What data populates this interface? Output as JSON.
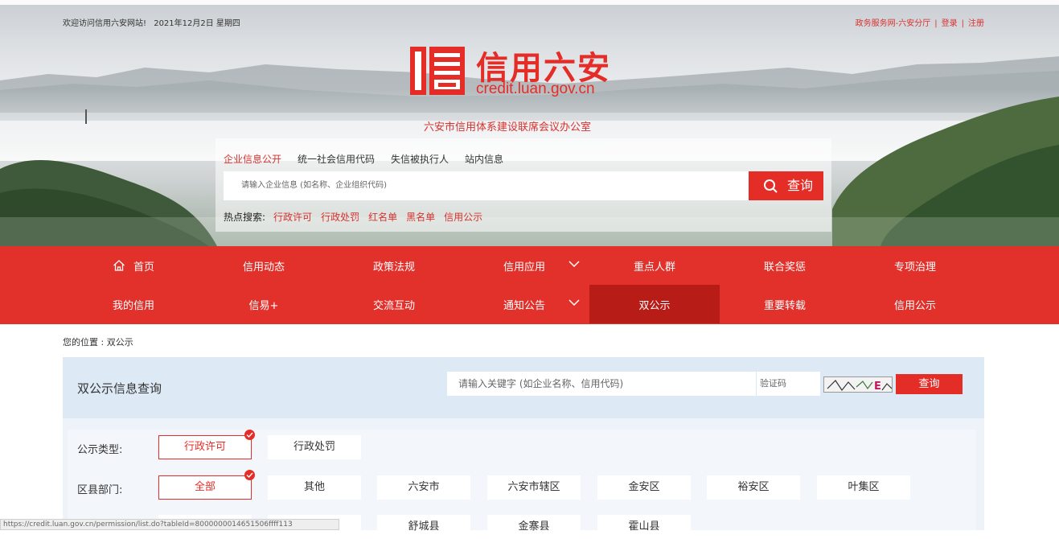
{
  "header": {
    "welcome": "欢迎访问信用六安网站!",
    "date": "2021年12月2日 星期四",
    "links": [
      "政务服务网-六安分厅",
      "登录",
      "注册"
    ],
    "separator": "|"
  },
  "logo": {
    "title": "信用六安",
    "domain": "credit.luan.gov.cn",
    "office": "六安市信用体系建设联席会议办公室"
  },
  "search": {
    "tabs": [
      "企业信息公开",
      "统一社会信用代码",
      "失信被执行人",
      "站内信息"
    ],
    "active_tab": 0,
    "placeholder": "请输入企业信息 (如名称、企业组织代码)",
    "button": "查询",
    "hot_label": "热点搜索:",
    "hot_links": [
      "行政许可",
      "行政处罚",
      "红名单",
      "黑名单",
      "信用公示"
    ]
  },
  "nav": {
    "row1": [
      "首页",
      "信用动态",
      "政策法规",
      "信用应用",
      "重点人群",
      "联合奖惩",
      "专项治理"
    ],
    "row2": [
      "我的信用",
      "信易+",
      "交流互动",
      "通知公告",
      "双公示",
      "重要转载",
      "信用公示"
    ],
    "active": "双公示"
  },
  "breadcrumb": "您的位置 : 双公示",
  "query": {
    "title": "双公示信息查询",
    "keyword_placeholder": "请输入关键字 (如企业名称、信用代码)",
    "captcha_placeholder": "验证码",
    "button": "查询"
  },
  "filters": {
    "type_label": "公示类型:",
    "types": [
      "行政许可",
      "行政处罚"
    ],
    "type_selected": "行政许可",
    "dept_label": "区县部门:",
    "depts_row1": [
      "全部",
      "其他",
      "六安市",
      "六安市辖区",
      "金安区",
      "裕安区",
      "叶集区"
    ],
    "depts_row2": [
      "",
      "",
      "舒城县",
      "金寨县",
      "霍山县"
    ],
    "dept_selected": "全部"
  },
  "statusbar": "https://credit.luan.gov.cn/permission/list.do?tableId=8000000014651506ffff113",
  "colors": {
    "brand_red": "#e2302b",
    "active_nav": "#b81c17",
    "panel_bg": "#eef3f9"
  }
}
